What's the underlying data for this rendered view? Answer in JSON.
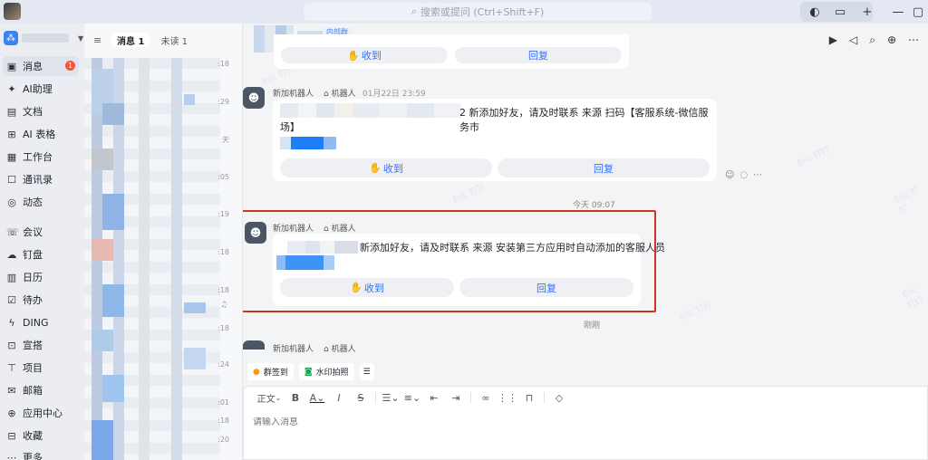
{
  "titlebar": {
    "search_placeholder": "搜索或提问 (Ctrl+Shift+F)"
  },
  "nav": {
    "badge": "1",
    "items": [
      {
        "label": "消息",
        "icon": "chat-bubble-icon"
      },
      {
        "label": "AI助理",
        "icon": "ai-sparkle-icon"
      },
      {
        "label": "文档",
        "icon": "document-icon"
      },
      {
        "label": "AI 表格",
        "icon": "table-icon"
      },
      {
        "label": "工作台",
        "icon": "grid-icon"
      },
      {
        "label": "通讯录",
        "icon": "contacts-icon"
      },
      {
        "label": "动态",
        "icon": "activity-icon"
      },
      {
        "label": "会议",
        "icon": "phone-icon"
      },
      {
        "label": "钉盘",
        "icon": "cloud-drive-icon"
      },
      {
        "label": "日历",
        "icon": "calendar-icon"
      },
      {
        "label": "待办",
        "icon": "checkbox-icon"
      },
      {
        "label": "DING",
        "icon": "lightning-icon"
      },
      {
        "label": "宣搭",
        "icon": "app-builder-icon"
      },
      {
        "label": "项目",
        "icon": "project-icon"
      },
      {
        "label": "邮箱",
        "icon": "mail-icon"
      },
      {
        "label": "应用中心",
        "icon": "app-center-icon"
      },
      {
        "label": "收藏",
        "icon": "bookmark-icon"
      },
      {
        "label": "更多",
        "icon": "more-icon"
      }
    ]
  },
  "convlist": {
    "tab_messages": "消息 1",
    "tab_unread": "未读 1",
    "times": [
      ":18",
      ":29",
      "天",
      ":05",
      ":19",
      ":18",
      ":18",
      ":18",
      ":24",
      ":01",
      ":18",
      ":20"
    ]
  },
  "chat": {
    "inner_tag": "内部群",
    "card1": {
      "receive": "收到",
      "reply": "回复"
    },
    "msg2": {
      "sender": "新加机器人",
      "tag": "机器人",
      "time": "01月22日 23:59",
      "text_line1": "2 新添加好友，请及时联系   来源 扫码【客服系统-微信服务市",
      "text_line2": "场】",
      "receive": "收到",
      "reply": "回复"
    },
    "divider_time": "今天 09:07",
    "msg3": {
      "sender": "新加机器人",
      "tag": "机器人",
      "text": "新添加好友，请及时联系   来源 安装第三方应用时自动添加的客服人员",
      "receive": "收到",
      "reply": "回复",
      "status": "刚刚"
    },
    "msg4": {
      "sender": "新加机器人",
      "tag": "机器人"
    },
    "watermark": "Eric 钉钉"
  },
  "composer": {
    "checkin": "群签到",
    "watermark_photo": "水印拍照",
    "format_body": "正文",
    "placeholder": "请输入消息"
  },
  "colors": {
    "accent": "#3370ff",
    "highlight": "#d93025",
    "badge": "#f5543c"
  }
}
